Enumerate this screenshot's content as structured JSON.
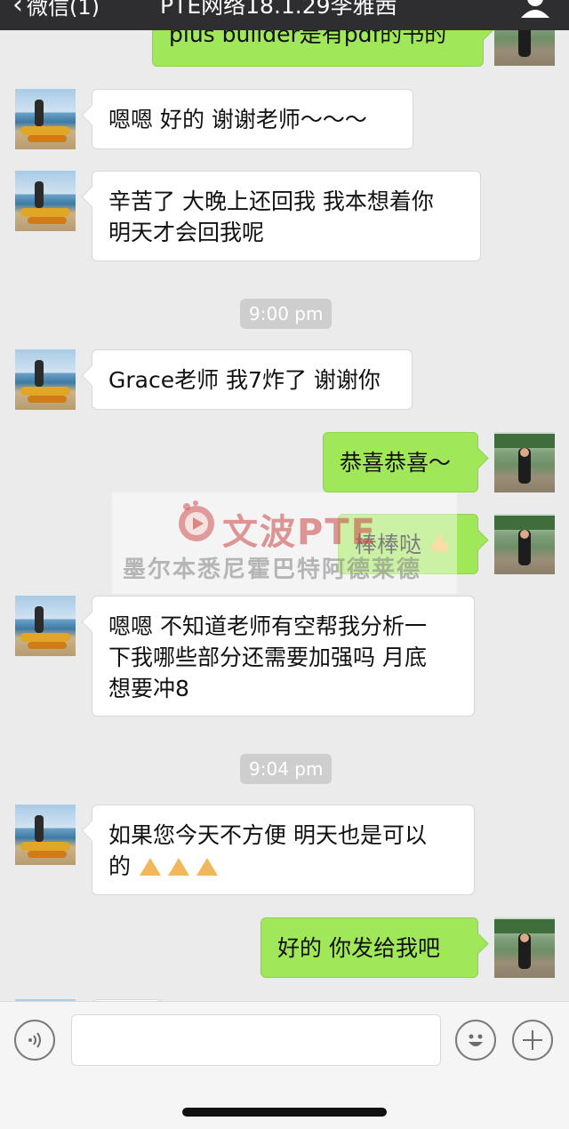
{
  "nav": {
    "back_label": "微信(1)",
    "title": "PTE网络18.1.29李雅茜"
  },
  "messages": [
    {
      "side": "right",
      "text": "plus builder是有pdf的书的"
    },
    {
      "side": "left",
      "text": "嗯嗯 好的 谢谢老师～～～"
    },
    {
      "side": "left",
      "line1": "辛苦了 大晚上还回我 我本想着你",
      "line2": "明天才会回我呢"
    },
    {
      "type": "time",
      "text": "9:00 pm"
    },
    {
      "side": "left",
      "text": "Grace老师 我7炸了 谢谢你"
    },
    {
      "side": "right",
      "text": "恭喜恭喜～"
    },
    {
      "side": "right",
      "text": "棒棒哒",
      "emoji": "thumbs-up-emoji"
    },
    {
      "side": "left",
      "line1": "嗯嗯 不知道老师有空帮我分析一",
      "line2": "下我哪些部分还需要加强吗 月底",
      "line3": "想要冲8"
    },
    {
      "type": "time",
      "text": "9:04 pm"
    },
    {
      "side": "left",
      "line1": "如果您今天不方便 明天也是可以",
      "line2": "的",
      "emoji": "pray-emoji"
    },
    {
      "side": "right",
      "text": "好的 你发给我吧"
    }
  ],
  "watermark": {
    "brand": "文波PTE",
    "cities": "墨尔本悉尼霍巴特阿德莱德"
  },
  "input_bar": {
    "voice_icon": "voice-icon",
    "emoji_icon": "emoji-icon",
    "plus_icon": "plus-icon"
  },
  "colors": {
    "nav_bg": "#2e2e30",
    "chat_bg": "#ebebeb",
    "outgoing_bubble": "#a0e75a",
    "incoming_bubble": "#ffffff",
    "timestamp_bg": "#cecece"
  }
}
